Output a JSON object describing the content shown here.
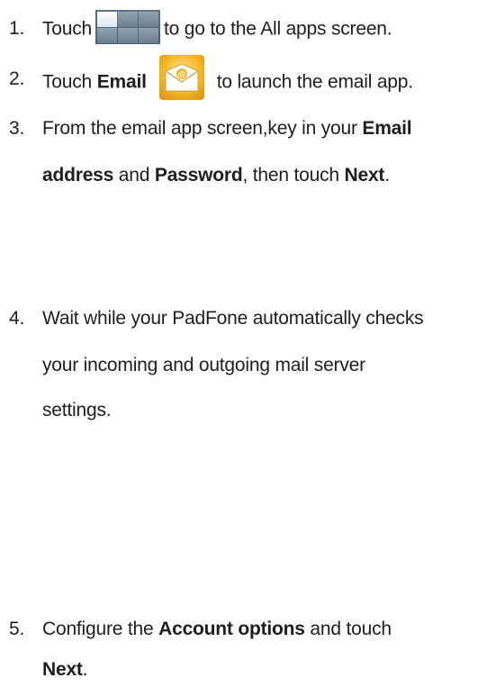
{
  "steps": [
    {
      "number": "1.",
      "parts": [
        "Touch",
        "to go to the All apps screen."
      ]
    },
    {
      "number": "2.",
      "parts": [
        "Touch",
        "Email",
        "to launch the email app."
      ]
    },
    {
      "number": "3.",
      "lines": [
        [
          "From the email app screen,key in your",
          "Email"
        ],
        [
          "address",
          "and",
          "Password",
          ", then  touch",
          "Next",
          "."
        ]
      ]
    },
    {
      "number": "4.",
      "lines": [
        "Wait while your PadFone automatically checks",
        "your incoming and outgoing mail server",
        "settings."
      ]
    },
    {
      "number": "5.",
      "lines": [
        [
          "Configure the",
          "Account options",
          "and touch"
        ],
        [
          "Next",
          "."
        ]
      ]
    }
  ],
  "icons": {
    "all_apps": "all-apps-grid-icon",
    "email": "email-app-icon"
  }
}
